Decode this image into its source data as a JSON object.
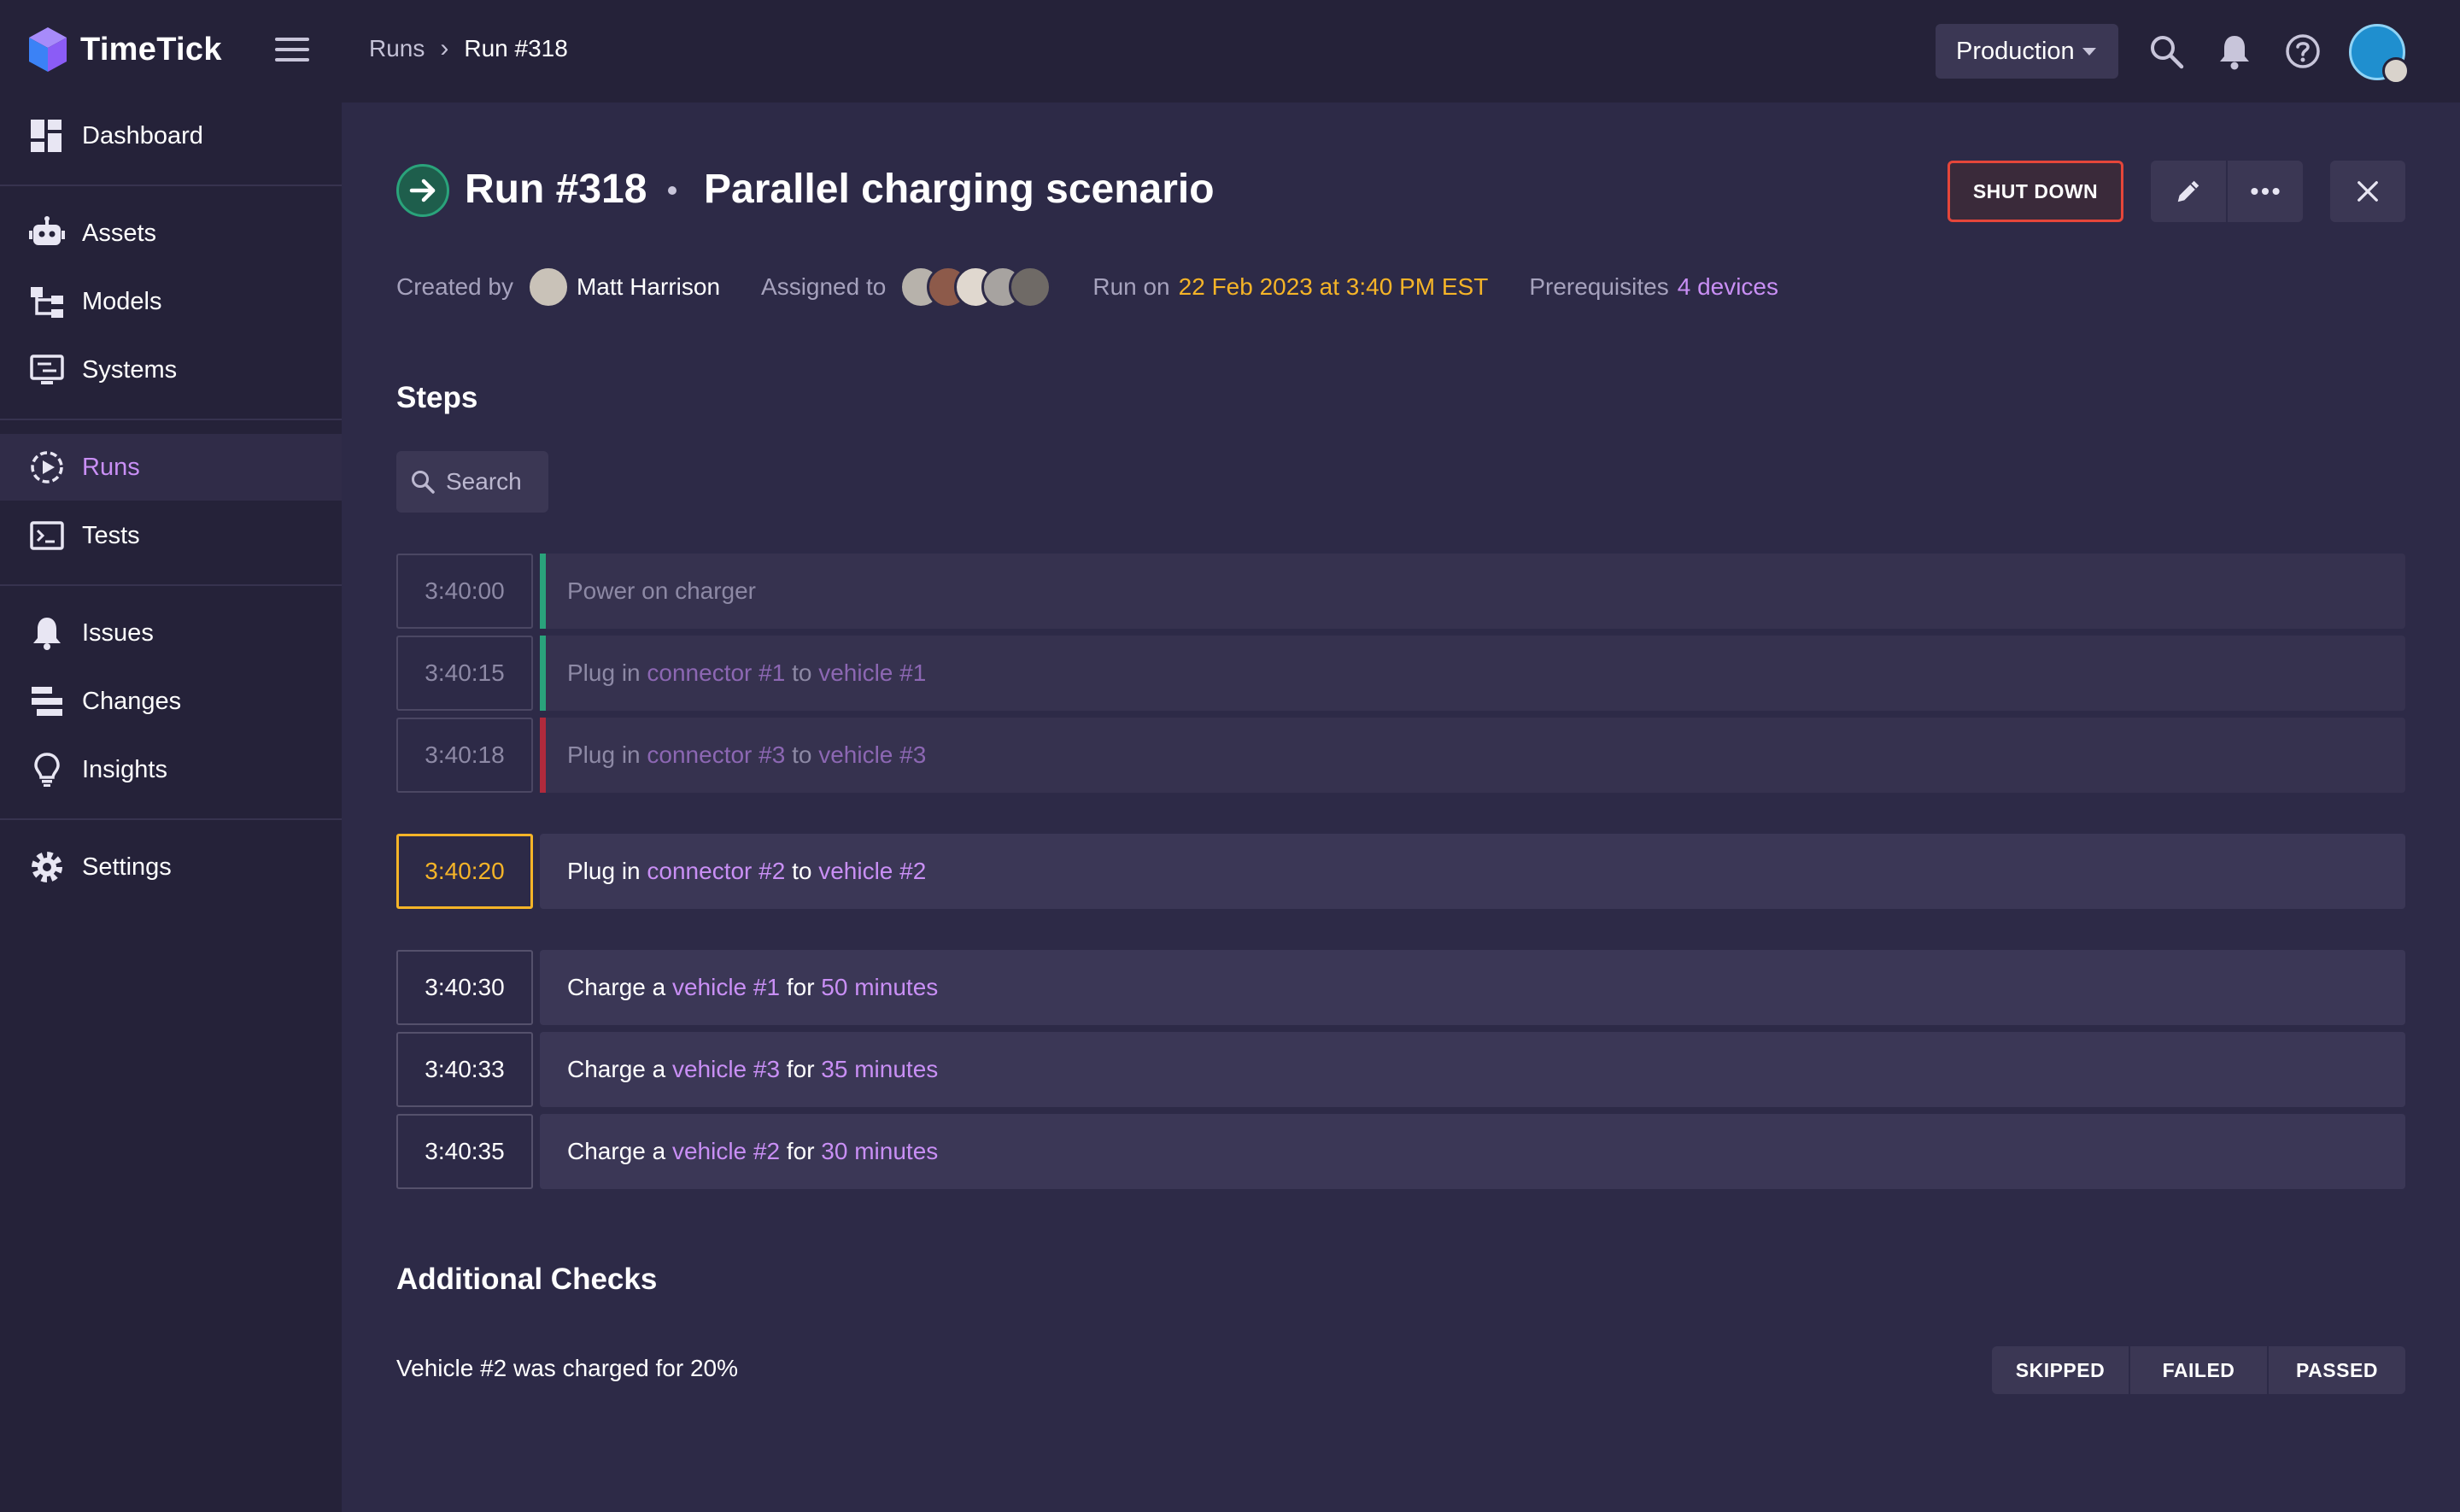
{
  "app": {
    "name": "TimeTick"
  },
  "breadcrumb": {
    "parent": "Runs",
    "separator": "›",
    "current": "Run #318"
  },
  "environment": {
    "selected": "Production"
  },
  "sidebar": {
    "items": [
      {
        "label": "Dashboard",
        "icon": "dashboard-icon"
      },
      {
        "label": "Assets",
        "icon": "robot-icon"
      },
      {
        "label": "Models",
        "icon": "hierarchy-icon"
      },
      {
        "label": "Systems",
        "icon": "monitor-icon"
      },
      {
        "label": "Runs",
        "icon": "play-circle-icon",
        "active": true
      },
      {
        "label": "Tests",
        "icon": "terminal-icon"
      },
      {
        "label": "Issues",
        "icon": "bell-icon"
      },
      {
        "label": "Changes",
        "icon": "changes-icon"
      },
      {
        "label": "Insights",
        "icon": "lightbulb-icon"
      },
      {
        "label": "Settings",
        "icon": "gear-icon"
      }
    ]
  },
  "run": {
    "title": "Run #318",
    "name": "Parallel charging scenario",
    "status_icon": "arrow-right-icon",
    "actions": {
      "shutdown": "SHUT DOWN"
    },
    "meta": {
      "created_by_label": "Created by",
      "created_by": "Matt Harrison",
      "assigned_to_label": "Assigned to",
      "run_on_label": "Run on",
      "run_on": "22 Feb 2023 at 3:40 PM EST",
      "prerequisites_label": "Prerequisites",
      "prerequisites": "4 devices"
    }
  },
  "steps": {
    "title": "Steps",
    "search_placeholder": "Search",
    "rows": [
      {
        "time": "3:40:00",
        "state": "done",
        "status_color": "#2aa37b",
        "parts": [
          {
            "t": "Power on charger"
          }
        ]
      },
      {
        "time": "3:40:15",
        "state": "done",
        "status_color": "#2aa37b",
        "parts": [
          {
            "t": "Plug in "
          },
          {
            "t": "connector #1",
            "link": true
          },
          {
            "t": " to "
          },
          {
            "t": "vehicle #1",
            "link": true
          }
        ]
      },
      {
        "time": "3:40:18",
        "state": "done",
        "status_color": "#b02a3c",
        "parts": [
          {
            "t": "Plug in "
          },
          {
            "t": "connector #3",
            "link": true
          },
          {
            "t": " to "
          },
          {
            "t": "vehicle #3",
            "link": true
          }
        ]
      },
      {
        "time": "3:40:20",
        "state": "current",
        "parts": [
          {
            "t": "Plug in "
          },
          {
            "t": "connector #2",
            "link": true
          },
          {
            "t": " to "
          },
          {
            "t": "vehicle #2",
            "link": true
          }
        ]
      },
      {
        "time": "3:40:30",
        "state": "pending",
        "parts": [
          {
            "t": "Charge a "
          },
          {
            "t": "vehicle #1",
            "link": true
          },
          {
            "t": " for "
          },
          {
            "t": "50 minutes",
            "link": true
          }
        ]
      },
      {
        "time": "3:40:33",
        "state": "pending",
        "parts": [
          {
            "t": "Charge a "
          },
          {
            "t": "vehicle #3",
            "link": true
          },
          {
            "t": " for "
          },
          {
            "t": "35 minutes",
            "link": true
          }
        ]
      },
      {
        "time": "3:40:35",
        "state": "pending",
        "parts": [
          {
            "t": "Charge a "
          },
          {
            "t": "vehicle #2",
            "link": true
          },
          {
            "t": " for "
          },
          {
            "t": "30 minutes",
            "link": true
          }
        ]
      }
    ]
  },
  "checks": {
    "title": "Additional Checks",
    "items": [
      {
        "text": "Vehicle #2 was charged for 20%",
        "options": [
          "SKIPPED",
          "FAILED",
          "PASSED"
        ]
      }
    ]
  },
  "colors": {
    "accent": "#c98ff5",
    "highlight": "#f5b428",
    "danger": "#e5463a",
    "success": "#2aa37b"
  }
}
